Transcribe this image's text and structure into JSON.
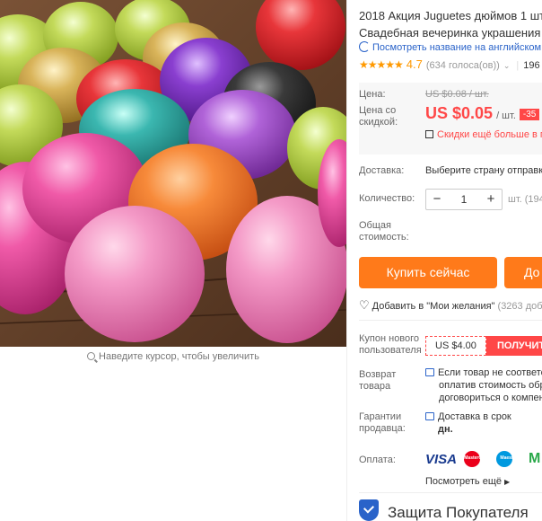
{
  "gallery": {
    "alt": "Воздушные шары",
    "zoom_hint": "Наведите курсор, чтобы увеличить"
  },
  "product": {
    "title_line1": "2018 Акция Juguetes дюймов 1 шт",
    "title_line2": "Свадебная вечеринка украшения",
    "translate_link": "Посмотреть название на английском",
    "stars": "★★★★★",
    "rating": "4.7",
    "votes": "(634 голоса(ов))",
    "orders": "196"
  },
  "price": {
    "price_label": "Цена:",
    "old_price": "US $0.08 / шт.",
    "discount_label_line1": "Цена со",
    "discount_label_line2": "скидкой:",
    "new_price": "US $0.05",
    "unit": "/ шт.",
    "discount_badge": "-35",
    "coupon_note": "Скидки ещё больше в п"
  },
  "shipping": {
    "label": "Доставка:",
    "value": "Выберите страну отправки"
  },
  "quantity": {
    "label": "Количество:",
    "minus": "−",
    "value": "1",
    "plus": "+",
    "stock": "шт. (194"
  },
  "total": {
    "label_line1": "Общая",
    "label_line2": "стоимость:"
  },
  "actions": {
    "buy_now": "Купить сейчас",
    "add_to_cart": "До",
    "wishlist": "Добавить в \"Мои желания\"",
    "wishlist_count": "(3263 доб"
  },
  "coupon": {
    "label_line1": "Купон нового",
    "label_line2": "пользователя",
    "value": "US $4.00",
    "get_button": "ПОЛУЧИТЕ"
  },
  "returns": {
    "label_line1": "Возврат",
    "label_line2": "товара",
    "line1": "Если товар не соответст",
    "line2": "оплатив стоимость обр",
    "line3": "договориться о компен"
  },
  "seller_guarantee": {
    "label_line1": "Гарантии",
    "label_line2": "продавца:",
    "line1": "Доставка в срок",
    "line2": "дн."
  },
  "payment": {
    "label": "Оплата:",
    "visa": "VISA",
    "mastercard": "MasterCard",
    "maestro": "Maestro",
    "more_logo": "M",
    "see_all": "Посмотреть ещё"
  },
  "protection": {
    "title": "Защита Покупателя"
  },
  "colors": {
    "accent_orange": "#ff7a1a",
    "price_red": "#ff4747",
    "link_blue": "#2a63c9",
    "star_orange": "#ff9900"
  }
}
